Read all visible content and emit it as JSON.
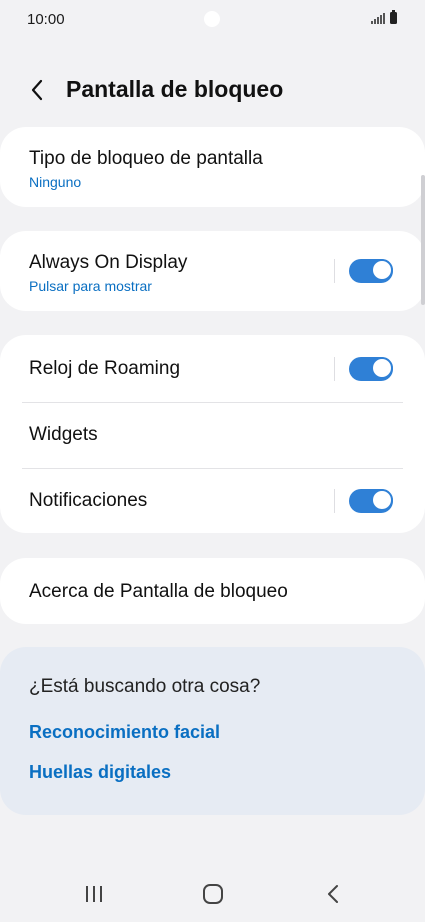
{
  "status_bar": {
    "time": "10:00"
  },
  "header": {
    "title": "Pantalla de bloqueo"
  },
  "lock_type": {
    "title": "Tipo de bloqueo de pantalla",
    "value": "Ninguno"
  },
  "always_on": {
    "title": "Always On Display",
    "subtitle": "Pulsar para mostrar",
    "enabled": true
  },
  "roaming_clock": {
    "title": "Reloj de Roaming",
    "enabled": true
  },
  "widgets": {
    "title": "Widgets"
  },
  "notifications": {
    "title": "Notificaciones",
    "enabled": true
  },
  "about": {
    "title": "Acerca de Pantalla de bloqueo"
  },
  "suggestions": {
    "title": "¿Está buscando otra cosa?",
    "links": [
      "Reconocimiento facial",
      "Huellas digitales"
    ]
  },
  "colors": {
    "accent": "#2f80d6",
    "link": "#0a6fc2",
    "background": "#f2f2f4",
    "card": "#ffffff",
    "suggestion_card": "#e6ebf3"
  },
  "icons": {
    "back": "back-arrow-icon",
    "nav_recents": "recents-icon",
    "nav_home": "home-icon",
    "nav_back": "nav-back-icon"
  }
}
